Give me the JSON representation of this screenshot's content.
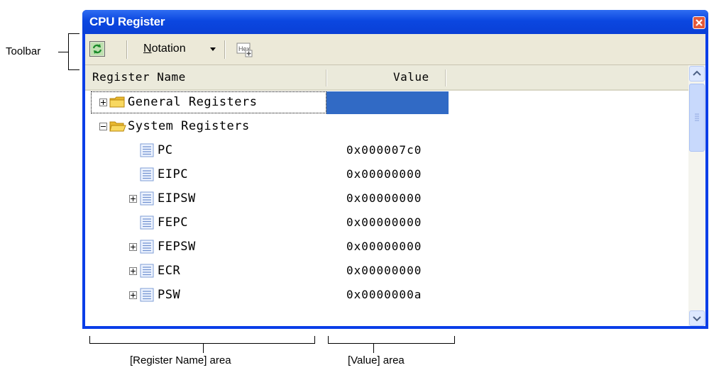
{
  "annotations": {
    "toolbar": "Toolbar",
    "register_name_area": "[Register Name] area",
    "value_area": "[Value] area"
  },
  "window": {
    "title": "CPU Register"
  },
  "toolbar": {
    "refresh_icon": "refresh-icon",
    "notation_label_u": "N",
    "notation_label_rest": "otation",
    "hex_icon": "hex-icon"
  },
  "table": {
    "headers": {
      "name": "Register Name",
      "value": "Value"
    },
    "rows": [
      {
        "name": "General Registers",
        "value": "",
        "icon": "folder-icon",
        "expand": "plus",
        "level": 0,
        "selected": true
      },
      {
        "name": "System Registers",
        "value": "",
        "icon": "folder-open-icon",
        "expand": "minus",
        "level": 0
      },
      {
        "name": "PC",
        "value": "0x000007c0",
        "icon": "register-icon",
        "expand": "",
        "level": 1
      },
      {
        "name": "EIPC",
        "value": "0x00000000",
        "icon": "register-icon",
        "expand": "",
        "level": 1
      },
      {
        "name": "EIPSW",
        "value": "0x00000000",
        "icon": "register-icon",
        "expand": "plus",
        "level": 1
      },
      {
        "name": "FEPC",
        "value": "0x00000000",
        "icon": "register-icon",
        "expand": "",
        "level": 1
      },
      {
        "name": "FEPSW",
        "value": "0x00000000",
        "icon": "register-icon",
        "expand": "plus",
        "level": 1
      },
      {
        "name": "ECR",
        "value": "0x00000000",
        "icon": "register-icon",
        "expand": "plus",
        "level": 1
      },
      {
        "name": "PSW",
        "value": "0x0000000a",
        "icon": "register-icon",
        "expand": "plus",
        "level": 1
      }
    ]
  },
  "colors": {
    "titlebar": "#0b47e0",
    "selection": "#316ac5",
    "toolbar_bg": "#ece9d8"
  }
}
